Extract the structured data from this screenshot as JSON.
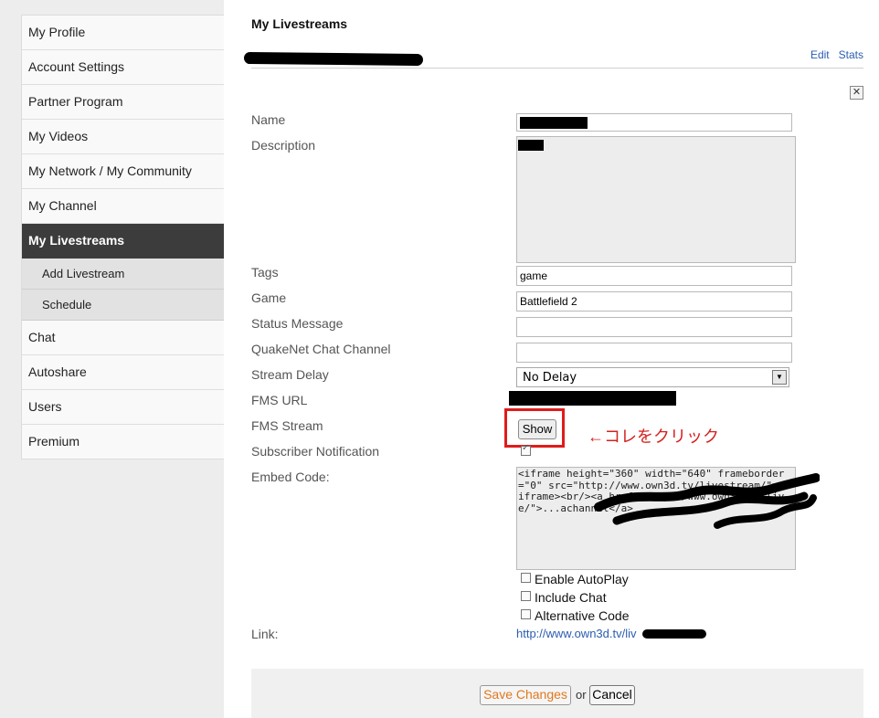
{
  "sidebar": {
    "items": [
      {
        "label": "My Profile"
      },
      {
        "label": "Account Settings"
      },
      {
        "label": "Partner Program"
      },
      {
        "label": "My Videos"
      },
      {
        "label": "My Network / My Community"
      },
      {
        "label": "My Channel"
      },
      {
        "label": "My Livestreams"
      }
    ],
    "subitems": [
      {
        "label": "Add Livestream"
      },
      {
        "label": "Schedule"
      }
    ],
    "items_after": [
      {
        "label": "Chat"
      },
      {
        "label": "Autoshare"
      },
      {
        "label": "Users"
      },
      {
        "label": "Premium"
      }
    ]
  },
  "header": {
    "title": "My Livestreams",
    "edit_label": "Edit",
    "stats_label": "Stats"
  },
  "form": {
    "name_label": "Name",
    "description_label": "Description",
    "tags_label": "Tags",
    "tags_value": "game",
    "game_label": "Game",
    "game_value": "Battlefield 2",
    "status_label": "Status Message",
    "status_value": "",
    "quakenet_label": "QuakeNet Chat Channel",
    "quakenet_value": "",
    "delay_label": "Stream Delay",
    "delay_value": "No Delay",
    "fms_url_label": "FMS URL",
    "fms_stream_label": "FMS Stream",
    "show_label": "Show",
    "subscriber_label": "Subscriber Notification",
    "embed_label": "Embed Code:",
    "embed_code": "<iframe height=\"360\" width=\"640\" frameborder=\"0\" src=\"http://www.own3d.tv/livestream/\"></iframe><br/><a href=\"http://www.own3d.tv/live/\">...achannel</a>",
    "autoplay_label": "Enable AutoPlay",
    "include_chat_label": "Include Chat",
    "alt_code_label": "Alternative Code",
    "link_label": "Link:",
    "link_value": "http://www.own3d.tv/liv"
  },
  "annotation": {
    "text": "←コレをクリック",
    "color": "#d42020"
  },
  "footer": {
    "save_label": "Save Changes",
    "or_label": "or",
    "cancel_label": "Cancel"
  }
}
